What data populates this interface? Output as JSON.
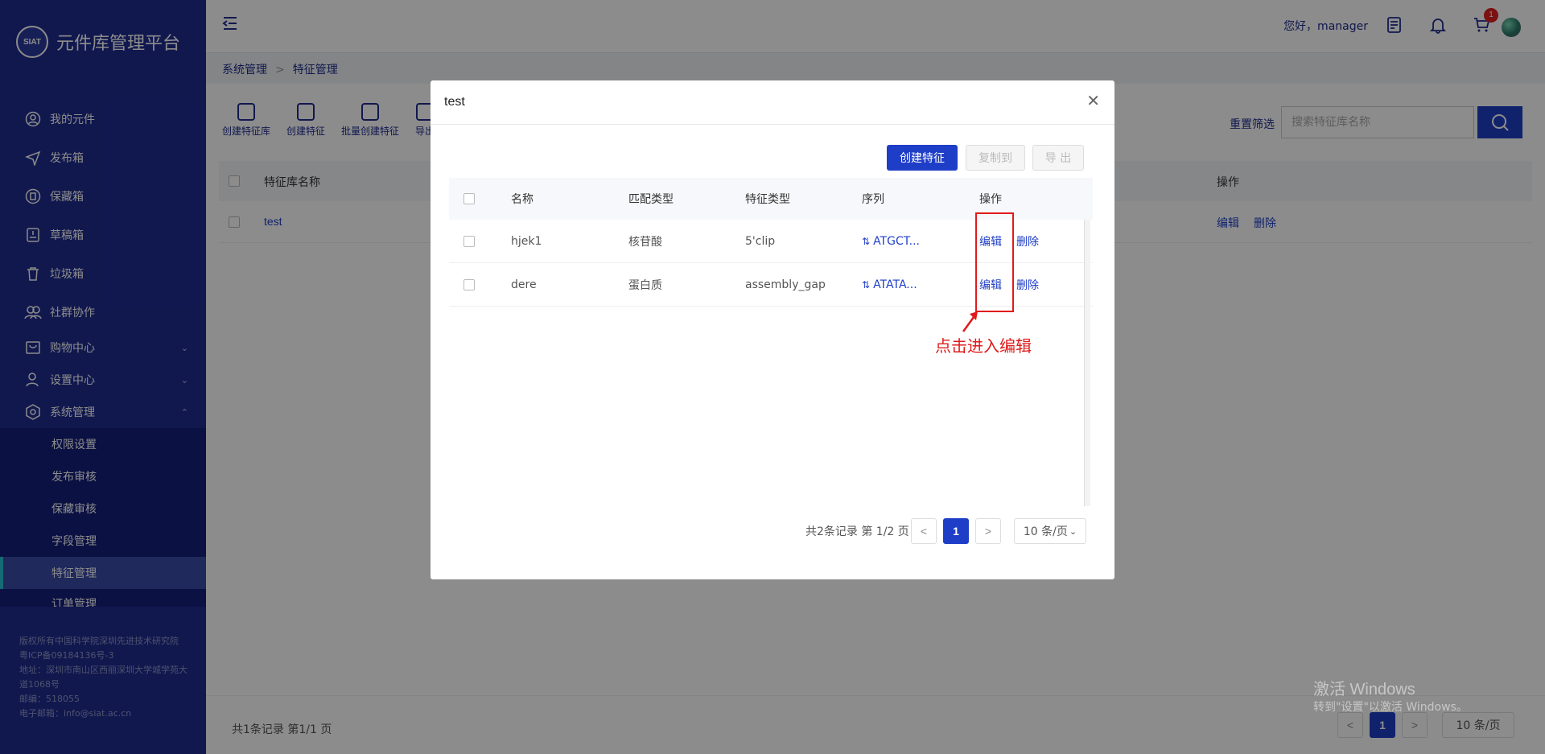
{
  "app": {
    "title": "元件库管理平台",
    "logo_text": "SIAT"
  },
  "sidebar": {
    "items": [
      {
        "label": "我的元件",
        "icon": "user-circle-icon"
      },
      {
        "label": "发布箱",
        "icon": "send-icon"
      },
      {
        "label": "保藏箱",
        "icon": "shield-icon"
      },
      {
        "label": "草稿箱",
        "icon": "draft-icon"
      },
      {
        "label": "垃圾箱",
        "icon": "trash-icon"
      },
      {
        "label": "社群协作",
        "icon": "group-icon"
      },
      {
        "label": "购物中心",
        "icon": "shop-icon"
      },
      {
        "label": "设置中心",
        "icon": "settings-user-icon"
      },
      {
        "label": "系统管理",
        "icon": "system-icon"
      }
    ],
    "sub_items": [
      {
        "label": "权限设置"
      },
      {
        "label": "发布审核"
      },
      {
        "label": "保藏审核"
      },
      {
        "label": "字段管理"
      },
      {
        "label": "特征管理"
      },
      {
        "label": "订单管理"
      }
    ],
    "footer": {
      "line1": "版权所有中国科学院深圳先进技术研究院 粤ICP备09184136号-3",
      "line2": "地址：深圳市南山区西丽深圳大学城学苑大道1068号",
      "line3": "邮编：518055",
      "line4": "电子邮箱：info@siat.ac.cn"
    }
  },
  "header": {
    "greeting": "您好，manager",
    "cart_count": "1"
  },
  "breadcrumb": {
    "parent": "系统管理",
    "separator": ">",
    "current": "特征管理"
  },
  "toolbar": {
    "create_library": "创建特征库",
    "create_feature": "创建特征",
    "batch_create": "批量创建特征",
    "export": "导出",
    "reset_filter": "重置筛选",
    "search_placeholder": "搜索特征库名称"
  },
  "bg_table": {
    "col_name": "特征库名称",
    "col_action": "操作",
    "row_name": "test",
    "edit": "编辑",
    "delete": "删除",
    "pagination_info": "共1条记录 第1/1 页",
    "page": "1",
    "page_size": "10 条/页"
  },
  "modal": {
    "title": "test",
    "create_button": "创建特征",
    "copy_button": "复制到",
    "export_button": "导 出",
    "columns": {
      "name": "名称",
      "match_type": "匹配类型",
      "feature_type": "特征类型",
      "sequence": "序列",
      "action": "操作"
    },
    "rows": [
      {
        "name": "hjek1",
        "match_type": "核苷酸",
        "feature_type": "5'clip",
        "sequence": "ATGCT...",
        "edit": "编辑",
        "delete": "删除"
      },
      {
        "name": "dere",
        "match_type": "蛋白质",
        "feature_type": "assembly_gap",
        "sequence": "ATATA...",
        "edit": "编辑",
        "delete": "删除"
      }
    ],
    "annotation": "点击进入编辑",
    "pagination_info": "共2条记录 第 1/2 页",
    "page": "1",
    "page_size": "10 条/页"
  },
  "watermark": {
    "line1": "激活 Windows",
    "line2": "转到\"设置\"以激活 Windows。"
  },
  "colors": {
    "sidebar": "#1f2c8f",
    "primary": "#1f3ec7",
    "annotation": "#e01a1a"
  }
}
